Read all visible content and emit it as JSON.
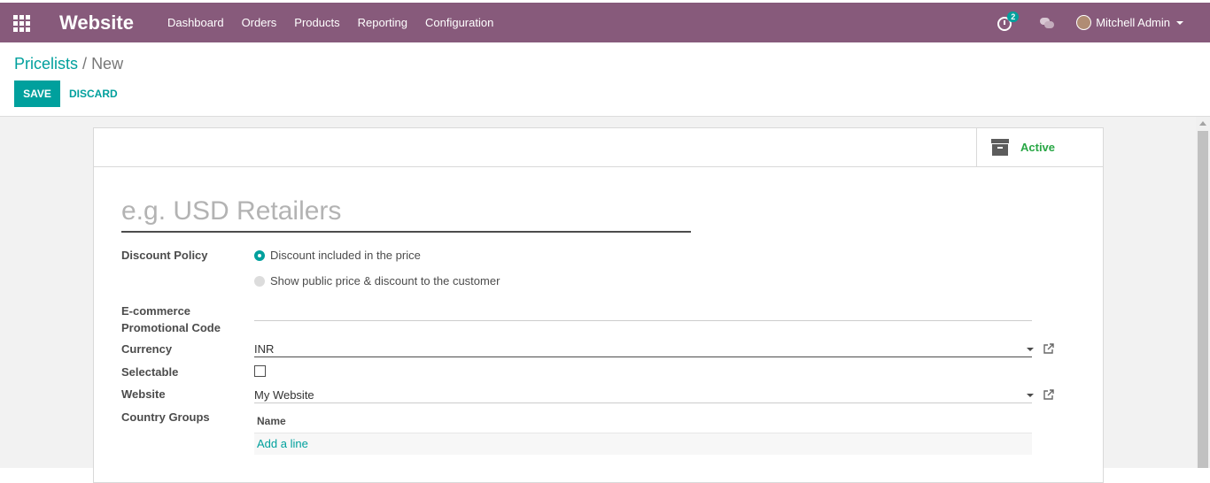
{
  "navbar": {
    "app_name": "Website",
    "menu": [
      "Dashboard",
      "Orders",
      "Products",
      "Reporting",
      "Configuration"
    ],
    "activity_count": "2",
    "user_name": "Mitchell Admin",
    "color": "#875a7b"
  },
  "breadcrumb": {
    "parent": "Pricelists",
    "separator": "/",
    "current": "New"
  },
  "buttons": {
    "save": "SAVE",
    "discard": "DISCARD"
  },
  "sheet": {
    "active_label": "Active",
    "name_placeholder": "e.g. USD Retailers",
    "discount_policy": {
      "label": "Discount Policy",
      "options": [
        "Discount included in the price",
        "Show public price & discount to the customer"
      ],
      "selected": 0
    },
    "promo_code": {
      "label_line1": "E-commerce",
      "label_line2": "Promotional Code",
      "value": ""
    },
    "currency": {
      "label": "Currency",
      "value": "INR"
    },
    "selectable": {
      "label": "Selectable",
      "checked": false
    },
    "website": {
      "label": "Website",
      "value": "My Website"
    },
    "country_groups": {
      "label": "Country Groups",
      "column": "Name",
      "add_line": "Add a line"
    }
  },
  "colors": {
    "accent": "#00a09d",
    "active": "#28a745"
  },
  "icons": [
    "apps-icon",
    "activity-clock-icon",
    "chat-icon",
    "avatar",
    "archive-icon",
    "external-link-icon",
    "chevron-down-icon"
  ]
}
